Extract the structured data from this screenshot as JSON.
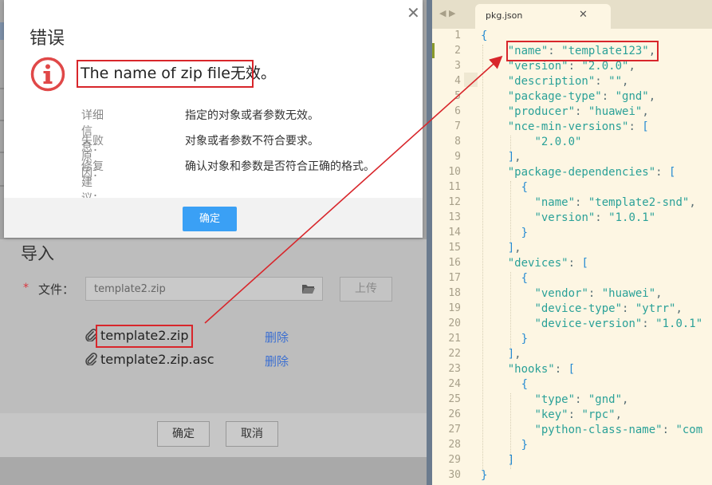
{
  "dialog": {
    "title": "错误",
    "message": "The name of zip file无效。",
    "details": [
      {
        "label": "详细信息：",
        "value": "指定的对象或者参数无效。"
      },
      {
        "label": "失败原因：",
        "value": "对象或者参数不符合要求。"
      },
      {
        "label": "修复建议：",
        "value": "确认对象和参数是否符合正确的格式。"
      }
    ],
    "ok_label": "确定",
    "close_symbol": "✕"
  },
  "import": {
    "title": "导入",
    "required_mark": "*",
    "file_label": "文件：",
    "file_value": "template2.zip",
    "upload_label": "上传",
    "files": [
      {
        "name": "template2.zip",
        "delete_label": "删除"
      },
      {
        "name": "template2.zip.asc",
        "delete_label": "删除"
      }
    ],
    "ok_label": "确定",
    "cancel_label": "取消"
  },
  "editor": {
    "nav": "◀ ▶",
    "tab_name": "pkg.json",
    "tab_close": "✕",
    "lines": [
      {
        "n": "1",
        "t": "{"
      },
      {
        "n": "2",
        "t": "    \"name\": \"template123\","
      },
      {
        "n": "3",
        "t": "    \"version\": \"2.0.0\","
      },
      {
        "n": "4",
        "t": "    \"description\": \"\","
      },
      {
        "n": "5",
        "t": "    \"package-type\": \"gnd\","
      },
      {
        "n": "6",
        "t": "    \"producer\": \"huawei\","
      },
      {
        "n": "7",
        "t": "    \"nce-min-versions\": ["
      },
      {
        "n": "8",
        "t": "        \"2.0.0\""
      },
      {
        "n": "9",
        "t": "    ],"
      },
      {
        "n": "10",
        "t": "    \"package-dependencies\": ["
      },
      {
        "n": "11",
        "t": "      {"
      },
      {
        "n": "12",
        "t": "        \"name\": \"template2-snd\","
      },
      {
        "n": "13",
        "t": "        \"version\": \"1.0.1\""
      },
      {
        "n": "14",
        "t": "      }"
      },
      {
        "n": "15",
        "t": "    ],"
      },
      {
        "n": "16",
        "t": "    \"devices\": ["
      },
      {
        "n": "17",
        "t": "      {"
      },
      {
        "n": "18",
        "t": "        \"vendor\": \"huawei\","
      },
      {
        "n": "19",
        "t": "        \"device-type\": \"ytrr\","
      },
      {
        "n": "20",
        "t": "        \"device-version\": \"1.0.1\""
      },
      {
        "n": "21",
        "t": "      }"
      },
      {
        "n": "22",
        "t": "    ],"
      },
      {
        "n": "23",
        "t": "    \"hooks\": ["
      },
      {
        "n": "24",
        "t": "      {"
      },
      {
        "n": "25",
        "t": "        \"type\": \"gnd\","
      },
      {
        "n": "26",
        "t": "        \"key\": \"rpc\","
      },
      {
        "n": "27",
        "t": "        \"python-class-name\": \"com"
      },
      {
        "n": "28",
        "t": "      }"
      },
      {
        "n": "29",
        "t": "    ]"
      },
      {
        "n": "30",
        "t": "}"
      }
    ]
  },
  "colors": {
    "highlight": "#d8262b",
    "primary_button": "#3aa0f5",
    "link": "#3b6fd1",
    "editor_bg": "#fdf6e3",
    "json_string": "#2aa198"
  }
}
